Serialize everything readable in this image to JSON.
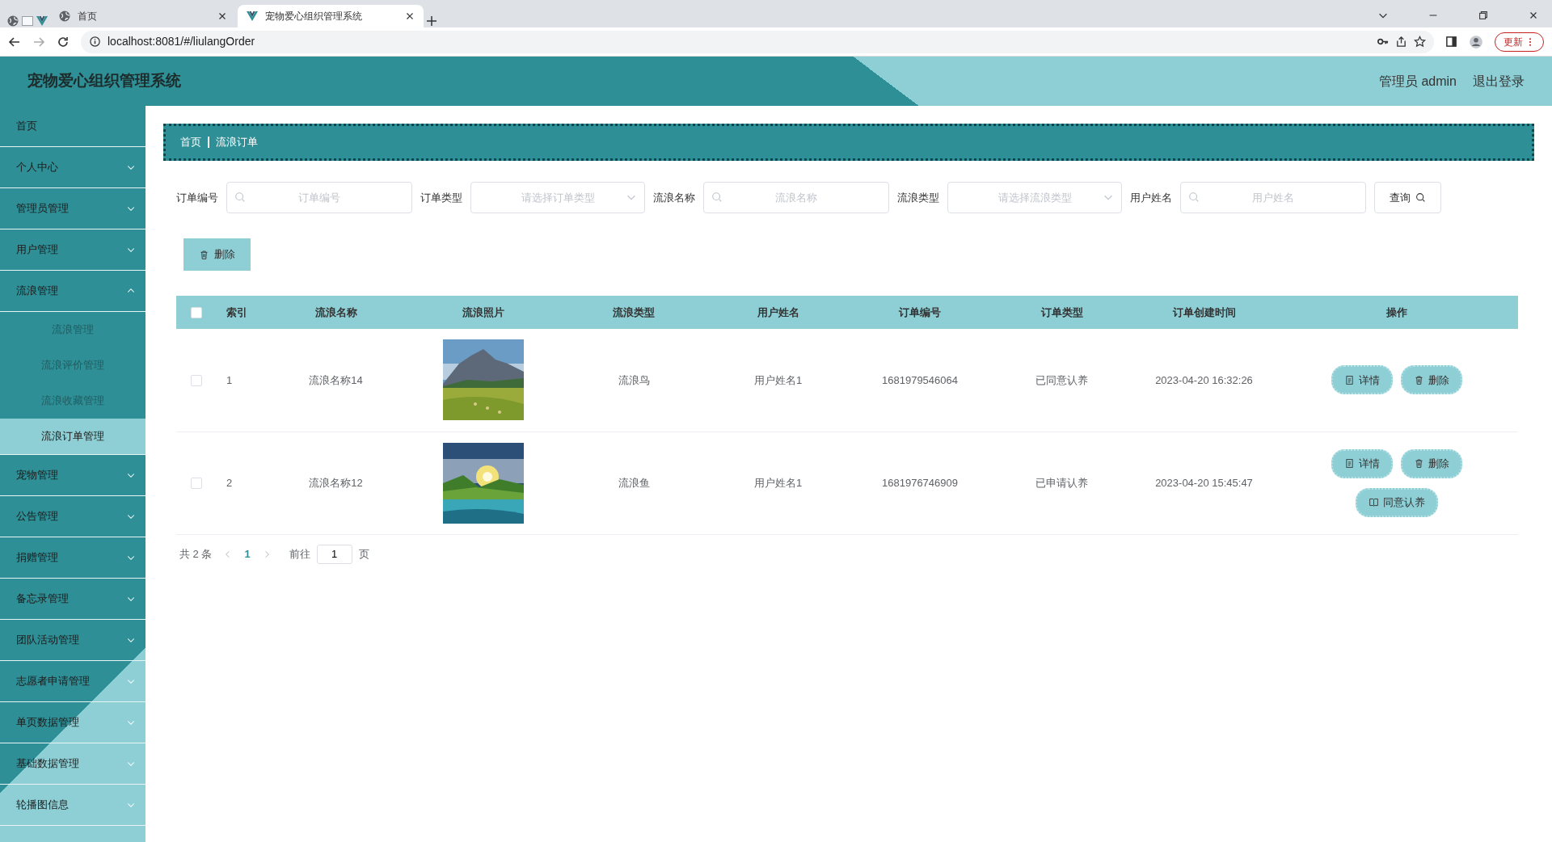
{
  "browser": {
    "tabs": [
      {
        "title": "首页",
        "selected": false,
        "kind": "globe"
      },
      {
        "title": "宠物爱心组织管理系统",
        "selected": true,
        "kind": "vue"
      }
    ],
    "url": "localhost:8081/#/liulangOrder",
    "update_button": "更新"
  },
  "header": {
    "title": "宠物爱心组织管理系统",
    "user": "管理员 admin",
    "logout": "退出登录"
  },
  "sidebar": {
    "items": [
      {
        "label": "首页",
        "kind": "link"
      },
      {
        "label": "个人中心",
        "kind": "menu",
        "expanded": false
      },
      {
        "label": "管理员管理",
        "kind": "menu",
        "expanded": false
      },
      {
        "label": "用户管理",
        "kind": "menu",
        "expanded": false
      },
      {
        "label": "流浪管理",
        "kind": "menu",
        "expanded": true,
        "children": [
          {
            "label": "流浪管理",
            "selected": false
          },
          {
            "label": "流浪评价管理",
            "selected": false
          },
          {
            "label": "流浪收藏管理",
            "selected": false
          },
          {
            "label": "流浪订单管理",
            "selected": true
          }
        ]
      },
      {
        "label": "宠物管理",
        "kind": "menu",
        "expanded": false
      },
      {
        "label": "公告管理",
        "kind": "menu",
        "expanded": false
      },
      {
        "label": "捐赠管理",
        "kind": "menu",
        "expanded": false
      },
      {
        "label": "备忘录管理",
        "kind": "menu",
        "expanded": false
      },
      {
        "label": "团队活动管理",
        "kind": "menu",
        "expanded": false
      },
      {
        "label": "志愿者申请管理",
        "kind": "menu",
        "expanded": false
      },
      {
        "label": "单页数据管理",
        "kind": "menu",
        "expanded": false
      },
      {
        "label": "基础数据管理",
        "kind": "menu",
        "expanded": false
      },
      {
        "label": "轮播图信息",
        "kind": "menu",
        "expanded": false
      }
    ]
  },
  "breadcrumb": [
    "首页",
    "流浪订单"
  ],
  "filters": [
    {
      "label": "订单编号",
      "kind": "text",
      "placeholder": "订单编号"
    },
    {
      "label": "订单类型",
      "kind": "select",
      "placeholder": "请选择订单类型"
    },
    {
      "label": "流浪名称",
      "kind": "text",
      "placeholder": "流浪名称"
    },
    {
      "label": "流浪类型",
      "kind": "select",
      "placeholder": "请选择流浪类型"
    },
    {
      "label": "用户姓名",
      "kind": "text",
      "placeholder": "用户姓名"
    }
  ],
  "query_button": "查询",
  "delete_button": "删除",
  "table": {
    "select_all": false,
    "columns": [
      "索引",
      "流浪名称",
      "流浪照片",
      "流浪类型",
      "用户姓名",
      "订单编号",
      "订单类型",
      "订单创建时间",
      "操作"
    ],
    "rows": [
      {
        "checked": false,
        "index": "1",
        "name": "流浪名称14",
        "photo": {
          "kind": "picture"
        },
        "type": "流浪鸟",
        "user": "用户姓名1",
        "order_no": "1681979546064",
        "order_type": "已同意认养",
        "created": "2023-04-20 16:32:26",
        "actions": [
          {
            "label": "详情",
            "kind": "detail"
          },
          {
            "label": "删除",
            "kind": "delete"
          }
        ]
      },
      {
        "checked": false,
        "index": "2",
        "name": "流浪名称12",
        "photo": {
          "kind": "picture"
        },
        "type": "流浪鱼",
        "user": "用户姓名1",
        "order_no": "1681976746909",
        "order_type": "已申请认养",
        "created": "2023-04-20 15:45:47",
        "actions": [
          {
            "label": "详情",
            "kind": "detail"
          },
          {
            "label": "删除",
            "kind": "delete"
          },
          {
            "label": "同意认养",
            "kind": "approve"
          }
        ]
      }
    ]
  },
  "pagination": {
    "total": "共 2 条",
    "pages": [
      {
        "label": "1",
        "selected": true
      }
    ],
    "goto": "前往",
    "page_input": "1",
    "suffix": "页"
  }
}
